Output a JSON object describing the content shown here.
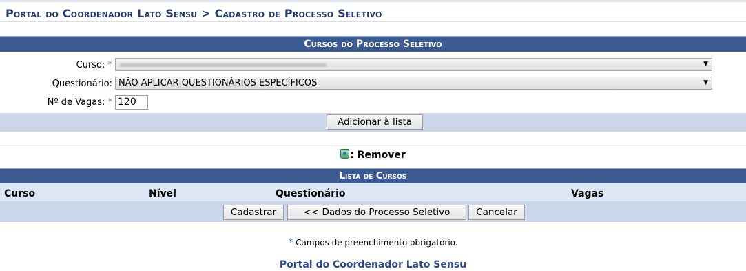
{
  "breadcrumb": "Portal do Coordenador Lato Sensu > Cadastro de Processo Seletivo",
  "cursos_panel": {
    "title": "Cursos do Processo Seletivo",
    "curso_label": "Curso:",
    "curso_value": "",
    "questionario_label": "Questionário:",
    "questionario_value": "NÃO APLICAR QUESTIONÁRIOS ESPECÍFICOS",
    "vagas_label": "Nº de Vagas:",
    "vagas_value": "120",
    "required_mark": "*",
    "add_button": "Adicionar à lista"
  },
  "legend": {
    "icon": "trash-icon",
    "text": ": Remover"
  },
  "lista": {
    "title": "Lista de Cursos",
    "columns": [
      "Curso",
      "Nível",
      "Questionário",
      "Vagas"
    ]
  },
  "actions": {
    "cadastrar": "Cadastrar",
    "voltar": "<< Dados do Processo Seletivo",
    "cancelar": "Cancelar"
  },
  "footer": {
    "required_mark": "*",
    "required_note": " Campos de preenchimento obrigatório.",
    "portal_link": "Portal do Coordenador Lato Sensu"
  },
  "colors": {
    "header_bg": "#3c5a92",
    "light_bar": "#cdd7eb",
    "link": "#2c4a87",
    "required": "#3874c9"
  }
}
